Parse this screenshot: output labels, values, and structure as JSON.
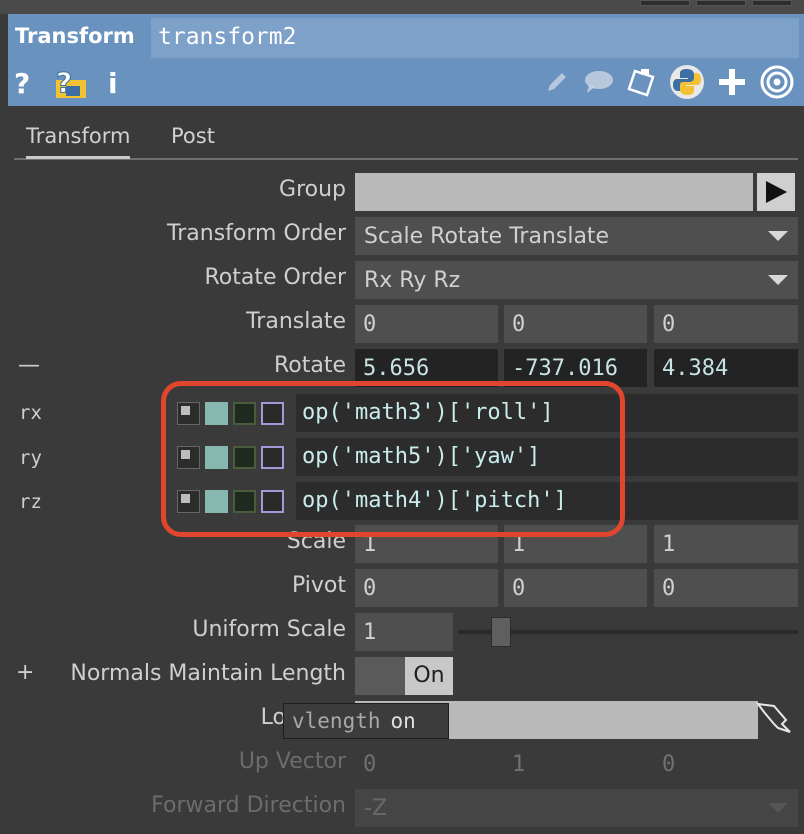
{
  "header": {
    "op_type": "Transform",
    "op_name": "transform2",
    "left_icons": [
      "question-icon",
      "help-python-icon",
      "info-icon"
    ],
    "right_icons": [
      "pencil-icon",
      "comment-icon",
      "clipboard-icon",
      "python-icon",
      "plus-icon",
      "target-icon"
    ]
  },
  "tabs": [
    {
      "label": "Transform",
      "active": true
    },
    {
      "label": "Post",
      "active": false
    }
  ],
  "params": {
    "group": {
      "label": "Group",
      "value": ""
    },
    "transform_order": {
      "label": "Transform Order",
      "value": "Scale Rotate Translate"
    },
    "rotate_order": {
      "label": "Rotate Order",
      "value": "Rx Ry Rz"
    },
    "translate": {
      "label": "Translate",
      "values": [
        "0",
        "0",
        "0"
      ]
    },
    "rotate": {
      "label": "Rotate",
      "collapse": "—",
      "values": [
        "5.656",
        "-737.016",
        "4.384"
      ]
    },
    "rx": {
      "label": "rx",
      "expr": "op('math3')['roll']"
    },
    "ry": {
      "label": "ry",
      "expr": "op('math5')['yaw']"
    },
    "rz": {
      "label": "rz",
      "expr": "op('math4')['pitch']"
    },
    "scale": {
      "label": "Scale",
      "values": [
        "1",
        "1",
        "1"
      ]
    },
    "pivot": {
      "label": "Pivot",
      "values": [
        "0",
        "0",
        "0"
      ]
    },
    "uniform_scale": {
      "label": "Uniform Scale",
      "value": "1",
      "slider": 0.1
    },
    "normals": {
      "expand": "+",
      "label": "Normals Maintain Length",
      "toggle": "On"
    },
    "lookat": {
      "label": "Lo"
    },
    "tooltip": {
      "name": "vlength",
      "value": "on"
    },
    "up_vector": {
      "label": "Up Vector",
      "values": [
        "0",
        "1",
        "0"
      ]
    },
    "forward_direction": {
      "label": "Forward Direction",
      "value": "-Z"
    }
  },
  "colors": {
    "header_bg": "#6a92bf",
    "highlight": "#e0452d",
    "expr_text": "#c9ecec"
  }
}
